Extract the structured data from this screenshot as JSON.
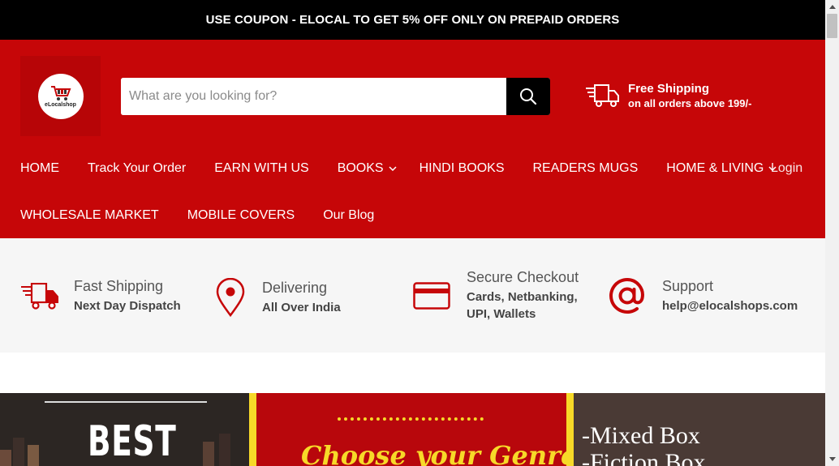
{
  "announcement": "USE COUPON - ELOCAL TO GET 5% OFF ONLY ON PREPAID ORDERS",
  "logo": {
    "text": "eLocalshop"
  },
  "search": {
    "placeholder": "What are you looking for?",
    "value": ""
  },
  "shipping": {
    "title": "Free Shipping",
    "subtitle": "on all orders above 199/-"
  },
  "nav": {
    "row1": [
      {
        "label": "HOME"
      },
      {
        "label": "Track Your Order"
      },
      {
        "label": "EARN WITH US"
      },
      {
        "label": "BOOKS",
        "dropdown": true
      },
      {
        "label": "HINDI BOOKS"
      },
      {
        "label": "READERS MUGS"
      },
      {
        "label": "HOME & LIVING",
        "dropdown": true
      }
    ],
    "row2": [
      {
        "label": "WHOLESALE MARKET"
      },
      {
        "label": "MOBILE COVERS"
      },
      {
        "label": "Our Blog"
      }
    ],
    "login": "Login"
  },
  "features": [
    {
      "icon": "truck-icon",
      "title": "Fast Shipping",
      "subtitle": "Next Day Dispatch"
    },
    {
      "icon": "location-pin-icon",
      "title": "Delivering",
      "subtitle": "All Over India"
    },
    {
      "icon": "credit-card-icon",
      "title": "Secure Checkout",
      "subtitle": "Cards, Netbanking, UPI, Wallets"
    },
    {
      "icon": "at-sign-icon",
      "title": "Support",
      "subtitle": "help@elocalshops.com"
    }
  ],
  "banners": {
    "best": "BEST",
    "genre": "Choose your Genre",
    "mixed_lines": [
      "-Mixed Box",
      "-Fiction Box"
    ]
  },
  "colors": {
    "brand_red": "#c60608",
    "black": "#000000",
    "feature_bg": "#f6f6f6",
    "accent_yellow": "#f7d928"
  }
}
